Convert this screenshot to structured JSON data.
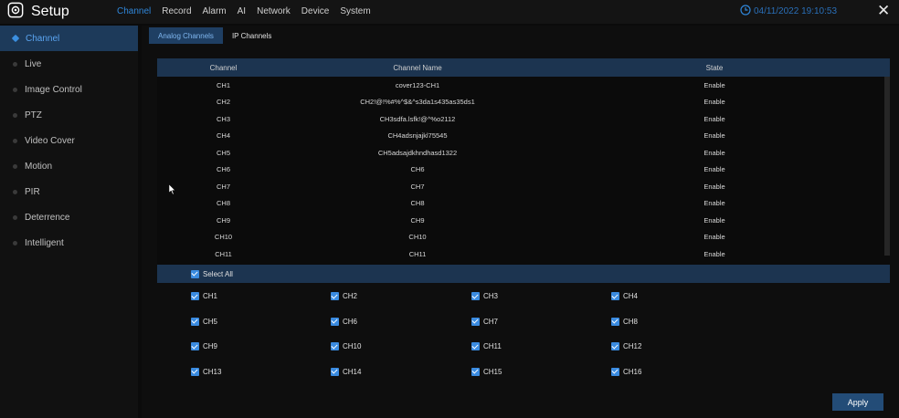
{
  "header": {
    "title": "Setup",
    "tabs": [
      "Channel",
      "Record",
      "Alarm",
      "AI",
      "Network",
      "Device",
      "System"
    ],
    "active_tab": "Channel",
    "datetime": "04/11/2022 19:10:53",
    "icons": {
      "logo": "gear-icon",
      "clock": "clock-icon",
      "close": "close-icon"
    },
    "close_glyph": "✕"
  },
  "sidebar": {
    "items": [
      {
        "label": "Channel",
        "active": true
      },
      {
        "label": "Live"
      },
      {
        "label": "Image Control"
      },
      {
        "label": "PTZ"
      },
      {
        "label": "Video Cover"
      },
      {
        "label": "Motion"
      },
      {
        "label": "PIR"
      },
      {
        "label": "Deterrence"
      },
      {
        "label": "Intelligent"
      }
    ]
  },
  "subtabs": [
    {
      "label": "Analog Channels",
      "active": true
    },
    {
      "label": "IP Channels"
    }
  ],
  "table": {
    "headers": [
      "Channel",
      "Channel Name",
      "State"
    ],
    "rows": [
      [
        "CH1",
        "cover123-CH1",
        "Enable"
      ],
      [
        "CH2",
        "CH2!@!%#%^$&^s3da1s435as35ds1",
        "Enable"
      ],
      [
        "CH3",
        "CH3sdfa.lsfk!@^%o2112",
        "Enable"
      ],
      [
        "CH4",
        "CH4adsnjajkl75545",
        "Enable"
      ],
      [
        "CH5",
        "CH5adsajdkhndhasd1322",
        "Enable"
      ],
      [
        "CH6",
        "CH6",
        "Enable"
      ],
      [
        "CH7",
        "CH7",
        "Enable"
      ],
      [
        "CH8",
        "CH8",
        "Enable"
      ],
      [
        "CH9",
        "CH9",
        "Enable"
      ],
      [
        "CH10",
        "CH10",
        "Enable"
      ],
      [
        "CH11",
        "CH11",
        "Enable"
      ]
    ]
  },
  "select_all": {
    "label": "Select All",
    "checked": true
  },
  "channel_checks": [
    "CH1",
    "CH2",
    "CH3",
    "CH4",
    "CH5",
    "CH6",
    "CH7",
    "CH8",
    "CH9",
    "CH10",
    "CH11",
    "CH12",
    "CH13",
    "CH14",
    "CH15",
    "CH16"
  ],
  "apply_label": "Apply",
  "colors": {
    "accent": "#2f86d9",
    "header_row": "#1c3450",
    "active_side": "#1d3a5a",
    "checkbox": "#3a8be0"
  }
}
